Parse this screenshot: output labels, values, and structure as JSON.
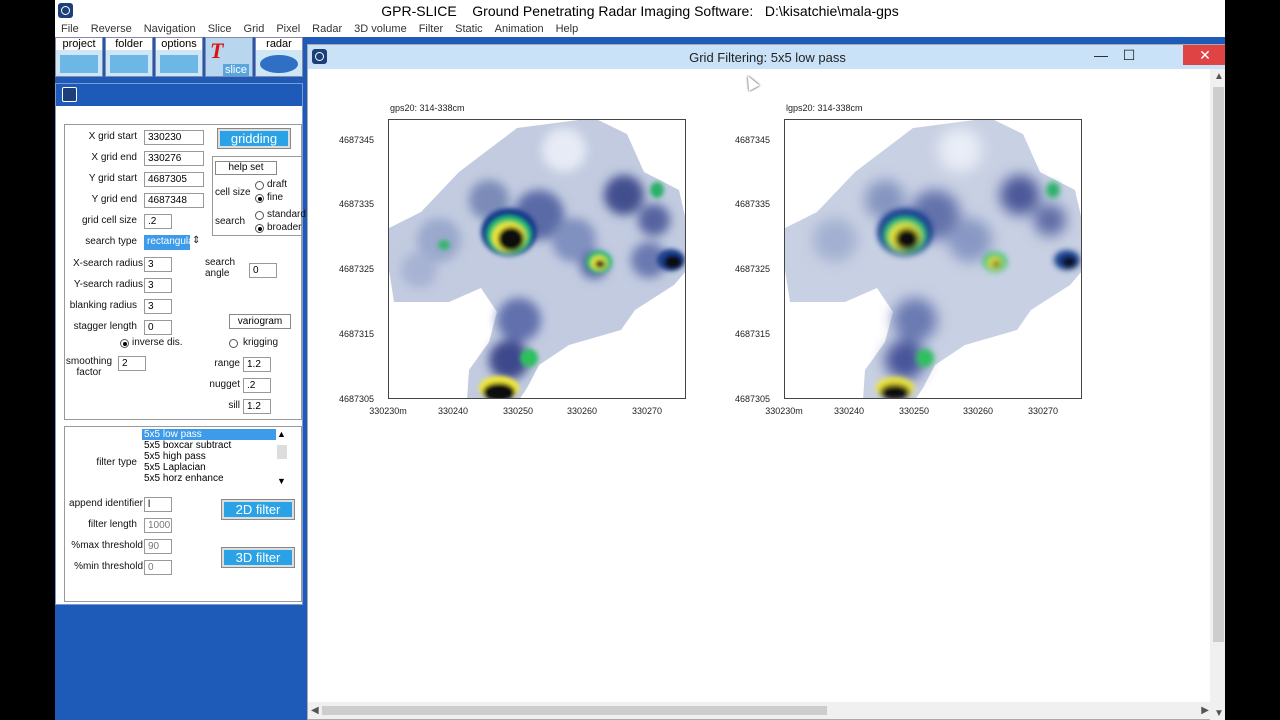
{
  "app": {
    "title": "GPR-SLICE    Ground Penetrating Radar Imaging Software:   D:\\kisatchie\\mala-gps"
  },
  "menu": [
    "File",
    "Reverse",
    "Navigation",
    "Slice",
    "Grid",
    "Pixel",
    "Radar",
    "3D volume",
    "Filter",
    "Static",
    "Animation",
    "Help"
  ],
  "toolbar": {
    "project": "project",
    "folder": "folder",
    "options": "options",
    "slice": "slice",
    "radar": "radar"
  },
  "gridding": {
    "x_grid_start_label": "X grid start",
    "x_grid_start": "330230",
    "x_grid_end_label": "X grid end",
    "x_grid_end": "330276",
    "y_grid_start_label": "Y grid start",
    "y_grid_start": "4687305",
    "y_grid_end_label": "Y grid end",
    "y_grid_end": "4687348",
    "grid_cell_size_label": "grid cell size",
    "grid_cell_size": ".2",
    "search_type_label": "search type",
    "search_type": "rectangula",
    "x_search_radius_label": "X-search radius",
    "x_search_radius": "3",
    "y_search_radius_label": "Y-search radius",
    "y_search_radius": "3",
    "blanking_radius_label": "blanking radius",
    "blanking_radius": "3",
    "stagger_length_label": "stagger length",
    "stagger_length": "0",
    "search_angle_label": "search angle",
    "search_angle": "0",
    "smoothing_factor_label": "smoothing factor",
    "smoothing_factor": "2",
    "range_label": "range",
    "range": "1.2",
    "nugget_label": "nugget",
    "nugget": ".2",
    "sill_label": "sill",
    "sill": "1.2",
    "gridding_button": "gridding",
    "help_set_button": "help set",
    "cell_size_label": "cell size",
    "draft": "draft",
    "fine": "fine",
    "search_label": "search",
    "standard": "standard",
    "broader": "broader",
    "variogram_button": "variogram",
    "inverse_dis": "inverse dis.",
    "krigging": "krigging"
  },
  "filter": {
    "filter_type_label": "filter type",
    "options": [
      "5x5 low pass",
      "5x5 boxcar subtract",
      "5x5 high pass",
      "5x5 Laplacian",
      "5x5 horz enhance"
    ],
    "append_identifier_label": "append identifier",
    "append_identifier": "l",
    "filter_length_label": "filter length",
    "filter_length": "1000",
    "max_threshold_label": "%max threshold",
    "max_threshold": "90",
    "min_threshold_label": "%min threshold",
    "min_threshold": "0",
    "filter_2d_button": "2D filter",
    "filter_3d_button": "3D filter"
  },
  "gf_window": {
    "title": "Grid Filtering: 5x5 low pass",
    "minimize": "—",
    "maximize": "☐",
    "close": "✕"
  },
  "plots": [
    {
      "title": "gps20: 314-338cm",
      "yticks": [
        "4687345",
        "4687335",
        "4687325",
        "4687315",
        "4687305"
      ],
      "xticks": [
        "330230m",
        "330240",
        "330250",
        "330260",
        "330270"
      ]
    },
    {
      "title": "lgps20: 314-338cm",
      "yticks": [
        "4687345",
        "4687335",
        "4687325",
        "4687315",
        "4687305"
      ],
      "xticks": [
        "330230m",
        "330240",
        "330250",
        "330260",
        "330270"
      ]
    }
  ]
}
